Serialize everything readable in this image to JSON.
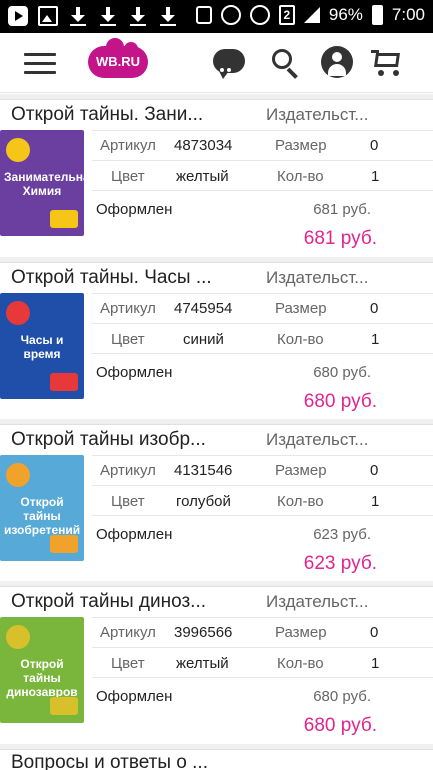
{
  "status_bar": {
    "battery": "96%",
    "time": "7:00",
    "sim": "2"
  },
  "header": {
    "logo_text": "WB.RU"
  },
  "labels": {
    "article": "Артикул",
    "size": "Размер",
    "color": "Цвет",
    "quantity": "Кол-во",
    "publisher": "Издательст..."
  },
  "orders": [
    {
      "title": "Открой тайны. Зани...",
      "cover_title": "Занимательная Химия",
      "cover_color": "#6a3fa0",
      "cover_accent": "#f5c518",
      "article": "4873034",
      "size": "0",
      "color": "желтый",
      "quantity": "1",
      "status": "Оформлен",
      "price": "681 руб.",
      "final_price": "681 руб."
    },
    {
      "title": "Открой тайны. Часы ...",
      "cover_title": "Часы и время",
      "cover_color": "#1f4fa8",
      "cover_accent": "#e8393a",
      "article": "4745954",
      "size": "0",
      "color": "синий",
      "quantity": "1",
      "status": "Оформлен",
      "price": "680 руб.",
      "final_price": "680 руб."
    },
    {
      "title": "Открой тайны изобр...",
      "cover_title": "Открой тайны изобретений",
      "cover_color": "#57a9d8",
      "cover_accent": "#f0a22a",
      "article": "4131546",
      "size": "0",
      "color": "голубой",
      "quantity": "1",
      "status": "Оформлен",
      "price": "623 руб.",
      "final_price": "623 руб."
    },
    {
      "title": "Открой тайны диноз...",
      "cover_title": "Открой тайны динозавров",
      "cover_color": "#7bb63c",
      "cover_accent": "#d8c02a",
      "article": "3996566",
      "size": "0",
      "color": "желтый",
      "quantity": "1",
      "status": "Оформлен",
      "price": "680 руб.",
      "final_price": "680 руб."
    }
  ],
  "next_item_title": "Вопросы и ответы о ...",
  "icons": [
    "youtube-icon",
    "image-icon",
    "download-icon",
    "mute-icon",
    "alarm-icon",
    "wifi-icon",
    "signal-icon",
    "battery-icon",
    "menu-icon",
    "chat-icon",
    "search-icon",
    "profile-icon",
    "cart-icon"
  ]
}
